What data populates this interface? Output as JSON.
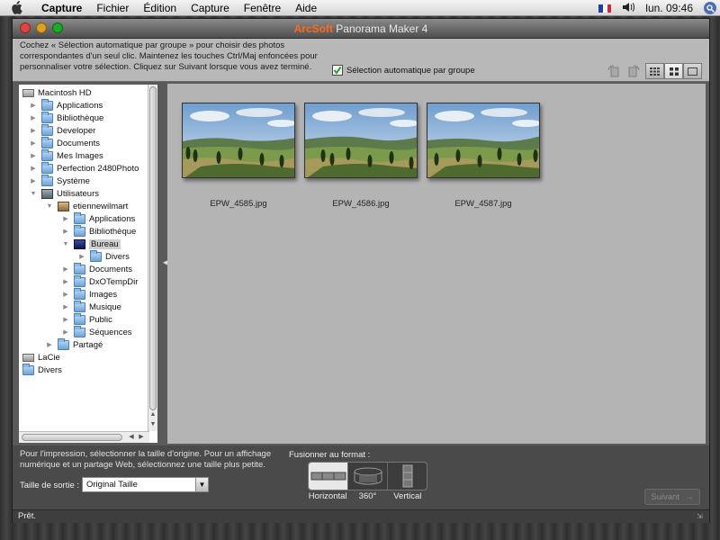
{
  "menubar": {
    "app": "Capture",
    "items": [
      "Fichier",
      "Édition",
      "Capture",
      "Fenêtre",
      "Aide"
    ],
    "clock": "lun. 09:46"
  },
  "window": {
    "title_brand": "ArcSoft",
    "title_rest": " Panorama Maker 4"
  },
  "topbar": {
    "instructions": "Cochez « Sélection automatique par groupe » pour choisir des photos correspondantes d'un seul clic. Maintenez les touches Ctrl/Maj enfoncées pour personnaliser votre sélection. Cliquez sur Suivant lorsque vous avez terminé.",
    "auto_select_label": "Sélection automatique par groupe",
    "auto_select_checked": true
  },
  "tree": [
    {
      "label": "Macintosh HD",
      "icon": "disk",
      "depth": 0,
      "expanded": true
    },
    {
      "label": "Applications",
      "icon": "folder",
      "depth": 1,
      "expanded": false
    },
    {
      "label": "Bibliothèque",
      "icon": "folder",
      "depth": 1,
      "expanded": false
    },
    {
      "label": "Developer",
      "icon": "folder",
      "depth": 1,
      "expanded": false
    },
    {
      "label": "Documents",
      "icon": "folder",
      "depth": 1,
      "expanded": false
    },
    {
      "label": "Mes Images",
      "icon": "folder",
      "depth": 1,
      "expanded": false
    },
    {
      "label": "Perfection 2480Photo",
      "icon": "folder",
      "depth": 1,
      "expanded": false
    },
    {
      "label": "Système",
      "icon": "folder",
      "depth": 1,
      "expanded": false
    },
    {
      "label": "Utilisateurs",
      "icon": "usr",
      "depth": 1,
      "expanded": true
    },
    {
      "label": "etiennewilmart",
      "icon": "home",
      "depth": 2,
      "expanded": true
    },
    {
      "label": "Applications",
      "icon": "folder",
      "depth": 3,
      "expanded": false
    },
    {
      "label": "Bibliothèque",
      "icon": "folder",
      "depth": 3,
      "expanded": false
    },
    {
      "label": "Bureau",
      "icon": "desk",
      "depth": 3,
      "expanded": true,
      "selected": true
    },
    {
      "label": "Divers",
      "icon": "folder",
      "depth": 4,
      "expanded": false
    },
    {
      "label": "Documents",
      "icon": "folder",
      "depth": 3,
      "expanded": false
    },
    {
      "label": "DxOTempDir",
      "icon": "folder",
      "depth": 3,
      "expanded": false
    },
    {
      "label": "Images",
      "icon": "folder",
      "depth": 3,
      "expanded": false
    },
    {
      "label": "Musique",
      "icon": "folder",
      "depth": 3,
      "expanded": false
    },
    {
      "label": "Public",
      "icon": "folder",
      "depth": 3,
      "expanded": false
    },
    {
      "label": "Séquences",
      "icon": "folder",
      "depth": 3,
      "expanded": false
    },
    {
      "label": "Partagé",
      "icon": "folder",
      "depth": 2,
      "expanded": false
    },
    {
      "label": "LaCie",
      "icon": "disk",
      "depth": 0,
      "expanded": null
    },
    {
      "label": "Divers",
      "icon": "folder",
      "depth": 0,
      "expanded": null
    }
  ],
  "photos": [
    {
      "name": "EPW_4585.jpg"
    },
    {
      "name": "EPW_4586.jpg"
    },
    {
      "name": "EPW_4587.jpg"
    }
  ],
  "bottom": {
    "hint": "Pour l'impression, sélectionner la taille d'origine. Pour un affichage numérique et un partage Web, sélectionnez une taille plus petite.",
    "size_label": "Taille de sortie :",
    "size_value": "Original Taille",
    "fusion_label": "Fusionner au format :",
    "formats": [
      "Horizontal",
      "360°",
      "Vertical"
    ],
    "next_label": "Suivant"
  },
  "status": "Prêt.",
  "colors": {
    "brand": "#ff6a1a",
    "close": "#e0443e",
    "minimize": "#dea123",
    "zoom": "#1aab29",
    "check": "#2aa12a"
  }
}
